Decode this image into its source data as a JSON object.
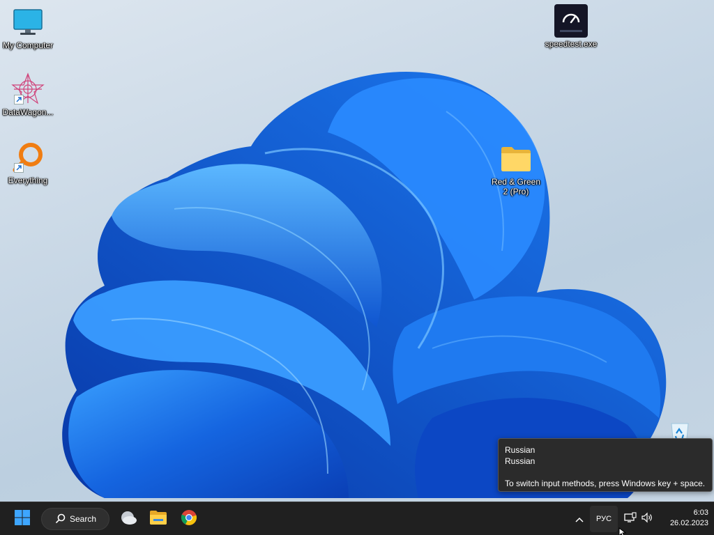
{
  "desktop": {
    "icons": [
      {
        "label": "My Computer",
        "icon": "monitor-icon"
      },
      {
        "label": "DataWagon...",
        "icon": "datawagon-icon"
      },
      {
        "label": "Everything",
        "icon": "everything-search-icon"
      },
      {
        "label": "speedtest.exe",
        "icon": "speedtest-icon"
      },
      {
        "label": "Red & Green\n2 (Pro)",
        "icon": "folder-icon"
      },
      {
        "label": "",
        "icon": "recycle-bin-icon"
      }
    ]
  },
  "tooltip": {
    "line1": "Russian",
    "line2": "Russian",
    "hint": "To switch input methods, press Windows key + space."
  },
  "taskbar": {
    "start_icon": "windows-start-icon",
    "search_label": "Search",
    "pinned": [
      "weather-widget-icon",
      "file-explorer-icon",
      "chrome-icon"
    ],
    "tray": {
      "overflow_icon": "chevron-up-icon",
      "language": "РУС",
      "network_icon": "network-icon",
      "volume_icon": "volume-icon",
      "time": "6:03",
      "date": "26.02.2023"
    }
  },
  "colors": {
    "taskbar_bg": "#202020",
    "wallpaper_blue": "#1a6fe0",
    "tooltip_bg": "#2b2b2b"
  }
}
